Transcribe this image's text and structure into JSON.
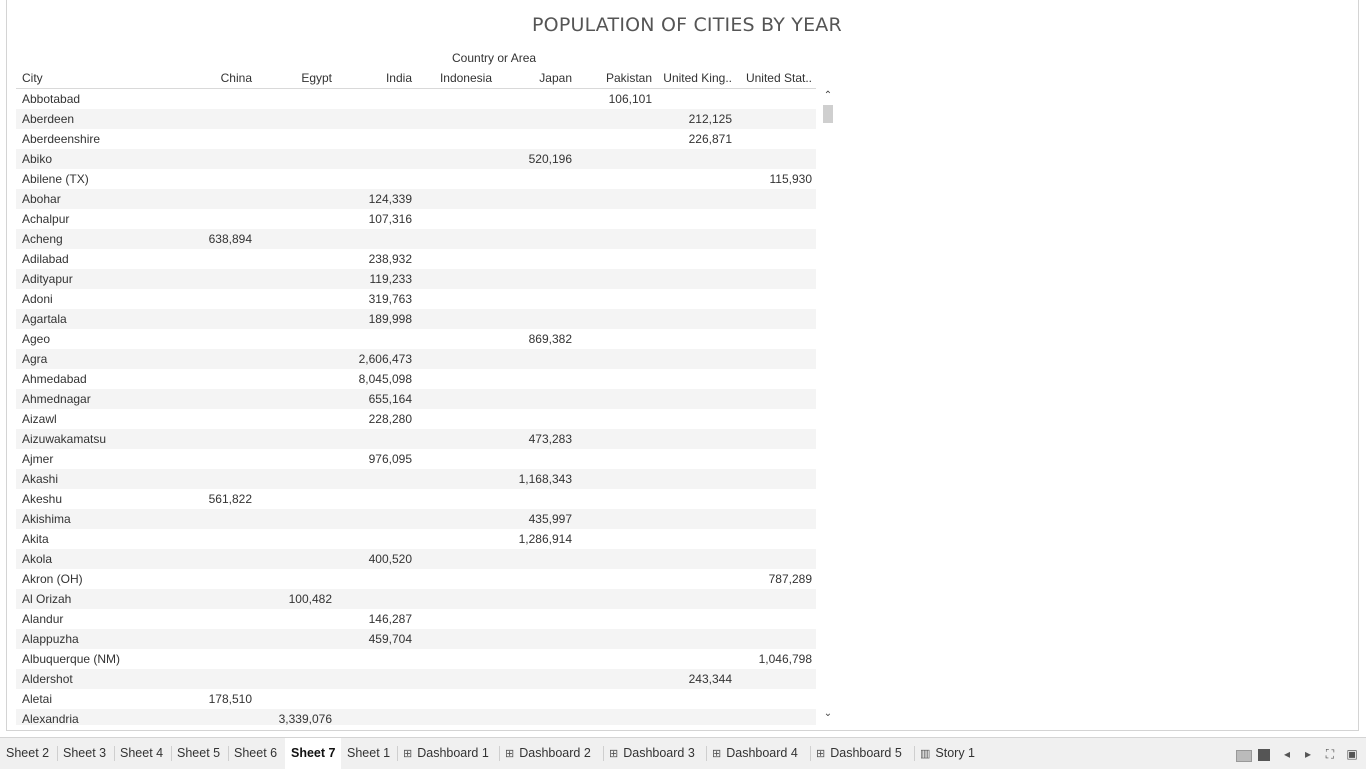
{
  "title": "POPULATION OF CITIES BY YEAR",
  "column_group_label": "Country or Area",
  "columns": {
    "city": "City",
    "countries": [
      "China",
      "Egypt",
      "India",
      "Indonesia",
      "Japan",
      "Pakistan",
      "United King..",
      "United Stat.."
    ]
  },
  "rows": [
    {
      "city": "Abbotabad",
      "values": [
        "",
        "",
        "",
        "",
        "",
        "106,101",
        "",
        ""
      ]
    },
    {
      "city": "Aberdeen",
      "values": [
        "",
        "",
        "",
        "",
        "",
        "",
        "212,125",
        ""
      ]
    },
    {
      "city": "Aberdeenshire",
      "values": [
        "",
        "",
        "",
        "",
        "",
        "",
        "226,871",
        ""
      ]
    },
    {
      "city": "Abiko",
      "values": [
        "",
        "",
        "",
        "",
        "520,196",
        "",
        "",
        ""
      ]
    },
    {
      "city": "Abilene (TX)",
      "values": [
        "",
        "",
        "",
        "",
        "",
        "",
        "",
        "115,930"
      ]
    },
    {
      "city": "Abohar",
      "values": [
        "",
        "",
        "124,339",
        "",
        "",
        "",
        "",
        ""
      ]
    },
    {
      "city": "Achalpur",
      "values": [
        "",
        "",
        "107,316",
        "",
        "",
        "",
        "",
        ""
      ]
    },
    {
      "city": "Acheng",
      "values": [
        "638,894",
        "",
        "",
        "",
        "",
        "",
        "",
        ""
      ]
    },
    {
      "city": "Adilabad",
      "values": [
        "",
        "",
        "238,932",
        "",
        "",
        "",
        "",
        ""
      ]
    },
    {
      "city": "Adityapur",
      "values": [
        "",
        "",
        "119,233",
        "",
        "",
        "",
        "",
        ""
      ]
    },
    {
      "city": "Adoni",
      "values": [
        "",
        "",
        "319,763",
        "",
        "",
        "",
        "",
        ""
      ]
    },
    {
      "city": "Agartala",
      "values": [
        "",
        "",
        "189,998",
        "",
        "",
        "",
        "",
        ""
      ]
    },
    {
      "city": "Ageo",
      "values": [
        "",
        "",
        "",
        "",
        "869,382",
        "",
        "",
        ""
      ]
    },
    {
      "city": "Agra",
      "values": [
        "",
        "",
        "2,606,473",
        "",
        "",
        "",
        "",
        ""
      ]
    },
    {
      "city": "Ahmedabad",
      "values": [
        "",
        "",
        "8,045,098",
        "",
        "",
        "",
        "",
        ""
      ]
    },
    {
      "city": "Ahmednagar",
      "values": [
        "",
        "",
        "655,164",
        "",
        "",
        "",
        "",
        ""
      ]
    },
    {
      "city": "Aizawl",
      "values": [
        "",
        "",
        "228,280",
        "",
        "",
        "",
        "",
        ""
      ]
    },
    {
      "city": "Aizuwakamatsu",
      "values": [
        "",
        "",
        "",
        "",
        "473,283",
        "",
        "",
        ""
      ]
    },
    {
      "city": "Ajmer",
      "values": [
        "",
        "",
        "976,095",
        "",
        "",
        "",
        "",
        ""
      ]
    },
    {
      "city": "Akashi",
      "values": [
        "",
        "",
        "",
        "",
        "1,168,343",
        "",
        "",
        ""
      ]
    },
    {
      "city": "Akeshu",
      "values": [
        "561,822",
        "",
        "",
        "",
        "",
        "",
        "",
        ""
      ]
    },
    {
      "city": "Akishima",
      "values": [
        "",
        "",
        "",
        "",
        "435,997",
        "",
        "",
        ""
      ]
    },
    {
      "city": "Akita",
      "values": [
        "",
        "",
        "",
        "",
        "1,286,914",
        "",
        "",
        ""
      ]
    },
    {
      "city": "Akola",
      "values": [
        "",
        "",
        "400,520",
        "",
        "",
        "",
        "",
        ""
      ]
    },
    {
      "city": "Akron (OH)",
      "values": [
        "",
        "",
        "",
        "",
        "",
        "",
        "",
        "787,289"
      ]
    },
    {
      "city": "Al Orizah",
      "values": [
        "",
        "100,482",
        "",
        "",
        "",
        "",
        "",
        ""
      ]
    },
    {
      "city": "Alandur",
      "values": [
        "",
        "",
        "146,287",
        "",
        "",
        "",
        "",
        ""
      ]
    },
    {
      "city": "Alappuzha",
      "values": [
        "",
        "",
        "459,704",
        "",
        "",
        "",
        "",
        ""
      ]
    },
    {
      "city": "Albuquerque (NM)",
      "values": [
        "",
        "",
        "",
        "",
        "",
        "",
        "",
        "1,046,798"
      ]
    },
    {
      "city": "Aldershot",
      "values": [
        "",
        "",
        "",
        "",
        "",
        "",
        "243,344",
        ""
      ]
    },
    {
      "city": "Aletai",
      "values": [
        "178,510",
        "",
        "",
        "",
        "",
        "",
        "",
        ""
      ]
    },
    {
      "city": "Alexandria",
      "values": [
        "",
        "3,339,076",
        "",
        "",
        "",
        "",
        "",
        ""
      ]
    }
  ],
  "tabs": [
    {
      "label": "Sheet 2",
      "icon": "",
      "active": false
    },
    {
      "label": "Sheet 3",
      "icon": "",
      "active": false
    },
    {
      "label": "Sheet 4",
      "icon": "",
      "active": false
    },
    {
      "label": "Sheet 5",
      "icon": "",
      "active": false
    },
    {
      "label": "Sheet 6",
      "icon": "",
      "active": false
    },
    {
      "label": "Sheet 7",
      "icon": "",
      "active": true
    },
    {
      "label": "Sheet 1",
      "icon": "",
      "active": false
    },
    {
      "label": "Dashboard 1",
      "icon": "dashboard-icon",
      "active": false
    },
    {
      "label": "Dashboard 2",
      "icon": "dashboard-icon",
      "active": false
    },
    {
      "label": "Dashboard 3",
      "icon": "dashboard-icon",
      "active": false
    },
    {
      "label": "Dashboard 4",
      "icon": "dashboard-icon",
      "active": false
    },
    {
      "label": "Dashboard 5",
      "icon": "dashboard-icon",
      "active": false
    },
    {
      "label": "Story 1",
      "icon": "story-icon",
      "active": false
    }
  ],
  "controls": [
    "filmstrip-view-icon",
    "tab-view-icon",
    "previous-sheet-icon",
    "next-sheet-icon",
    "fullscreen-icon",
    "presentation-mode-icon"
  ]
}
